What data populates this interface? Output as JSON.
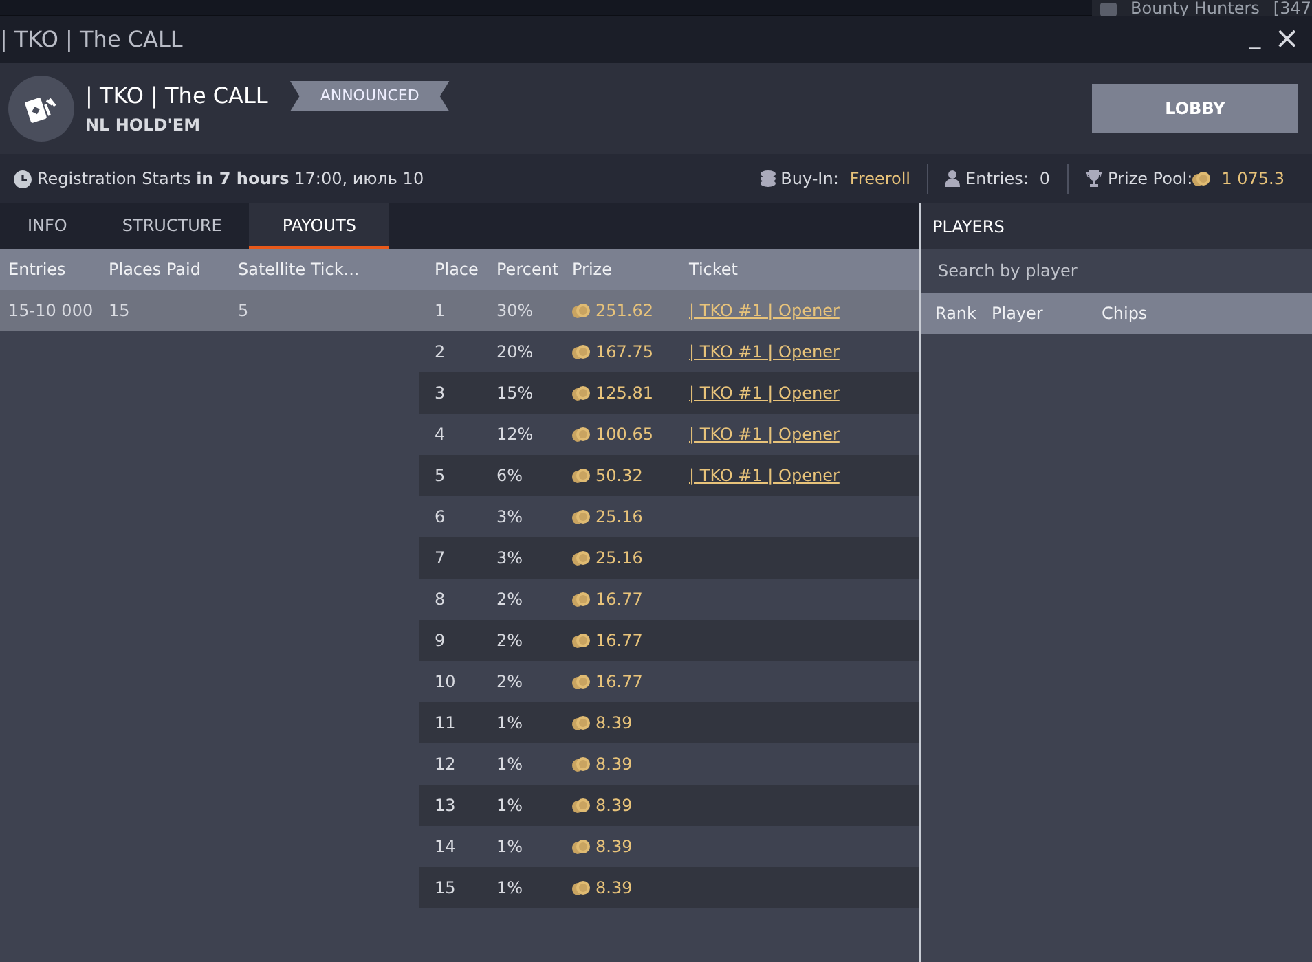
{
  "background_window": {
    "title": "Bounty Hunters",
    "column": "[347"
  },
  "window": {
    "title": "| TKO | The CALL",
    "buttons": [
      {
        "kind": "minimize",
        "label": "_"
      },
      {
        "kind": "close",
        "label": "×"
      }
    ]
  },
  "header": {
    "name": "| TKO | The CALL",
    "status": "ANNOUNCED",
    "game": "NL HOLD'EM",
    "button": "LOBBY"
  },
  "info_bar": {
    "registration": "Registration Starts **in 7 hours** 17:00, июль 10",
    "buy_in_label": "Buy-In:",
    "buy_in": "Freeroll",
    "entries_label": "Entries:",
    "entries": "0",
    "prize_pool_label": "Prize Pool:",
    "prize_pool": "1 075.3"
  },
  "tabs": [
    {
      "label": "INFO",
      "selected": false
    },
    {
      "label": "STRUCTURE",
      "selected": false
    },
    {
      "label": "PAYOUTS",
      "selected": true
    }
  ],
  "summary": {
    "columns": [
      "Entries",
      "Places Paid",
      "Satellite Tick..."
    ],
    "rows": [
      {
        "cells": [
          "15-10 000",
          "15",
          "5"
        ],
        "selected": true
      }
    ]
  },
  "payouts": {
    "columns": [
      "Place",
      "Percent",
      "Prize",
      "Ticket"
    ],
    "rows": [
      {
        "place": "1",
        "percent": "30%",
        "prize": "251.62",
        "ticket": "| TKO #1 |  Opener",
        "selected": true
      },
      {
        "place": "2",
        "percent": "20%",
        "prize": "167.75",
        "ticket": "| TKO #1 |  Opener",
        "selected": false
      },
      {
        "place": "3",
        "percent": "15%",
        "prize": "125.81",
        "ticket": "| TKO #1 |  Opener",
        "selected": false
      },
      {
        "place": "4",
        "percent": "12%",
        "prize": "100.65",
        "ticket": "| TKO #1 |  Opener",
        "selected": false
      },
      {
        "place": "5",
        "percent": "6%",
        "prize": "50.32",
        "ticket": "| TKO #1 |  Opener",
        "selected": false
      },
      {
        "place": "6",
        "percent": "3%",
        "prize": "25.16",
        "selected": false
      },
      {
        "place": "7",
        "percent": "3%",
        "prize": "25.16",
        "selected": false
      },
      {
        "place": "8",
        "percent": "2%",
        "prize": "16.77",
        "selected": false
      },
      {
        "place": "9",
        "percent": "2%",
        "prize": "16.77",
        "selected": false
      },
      {
        "place": "10",
        "percent": "2%",
        "prize": "16.77",
        "selected": false
      },
      {
        "place": "11",
        "percent": "1%",
        "prize": "8.39",
        "selected": false
      },
      {
        "place": "12",
        "percent": "1%",
        "prize": "8.39",
        "selected": false
      },
      {
        "place": "13",
        "percent": "1%",
        "prize": "8.39",
        "selected": false
      },
      {
        "place": "14",
        "percent": "1%",
        "prize": "8.39",
        "selected": false
      },
      {
        "place": "15",
        "percent": "1%",
        "prize": "8.39",
        "selected": false
      }
    ]
  },
  "players": {
    "title": "PLAYERS",
    "search": {
      "placeholder": "Search by player"
    },
    "columns": [
      "Rank",
      "Player",
      "Chips"
    ]
  }
}
